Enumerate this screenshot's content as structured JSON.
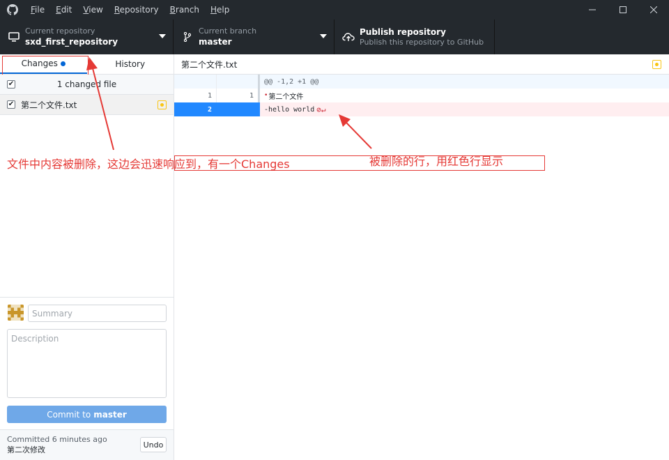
{
  "menu": {
    "items": [
      {
        "label": "File",
        "key": "F",
        "rest": "ile"
      },
      {
        "label": "Edit",
        "key": "E",
        "rest": "dit"
      },
      {
        "label": "View",
        "key": "V",
        "rest": "iew"
      },
      {
        "label": "Repository",
        "key": "R",
        "rest": "epository"
      },
      {
        "label": "Branch",
        "key": "B",
        "rest": "ranch"
      },
      {
        "label": "Help",
        "key": "H",
        "rest": "elp"
      }
    ]
  },
  "window": {
    "minimize": "—",
    "maximize": "☐",
    "close": "✕"
  },
  "toolbar": {
    "repo_label": "Current repository",
    "repo_value": "sxd_first_repository",
    "branch_label": "Current branch",
    "branch_value": "master",
    "publish_title": "Publish repository",
    "publish_sub": "Publish this repository to GitHub"
  },
  "sidebar": {
    "tab_changes": "Changes",
    "tab_history": "History",
    "changed_count": "1 changed file",
    "files": [
      {
        "name": "第二个文件.txt",
        "status": "modified"
      }
    ]
  },
  "commit": {
    "summary_placeholder": "Summary",
    "description_placeholder": "Description",
    "button_prefix": "Commit to",
    "button_branch": "master",
    "last_commit_time": "Committed 6 minutes ago",
    "last_commit_msg": "第二次修改",
    "undo_label": "Undo"
  },
  "diff": {
    "file_name": "第二个文件.txt",
    "hunk_header": "@@ -1,2 +1 @@",
    "rows": [
      {
        "old": "1",
        "new": "1",
        "text": "第二个文件",
        "type": "context"
      },
      {
        "old": "2",
        "new": "",
        "text": "-hello world",
        "type": "deleted"
      }
    ]
  },
  "annotations": {
    "changes_note": "文件中内容被删除，这边会迅速响应到，有一个Changes",
    "deleted_note": "被删除的行，用红色行显示"
  },
  "colors": {
    "accent": "#0366d6",
    "annotation": "#e53935",
    "modified": "#f9c513",
    "deleted_bg": "#ffeef0"
  }
}
